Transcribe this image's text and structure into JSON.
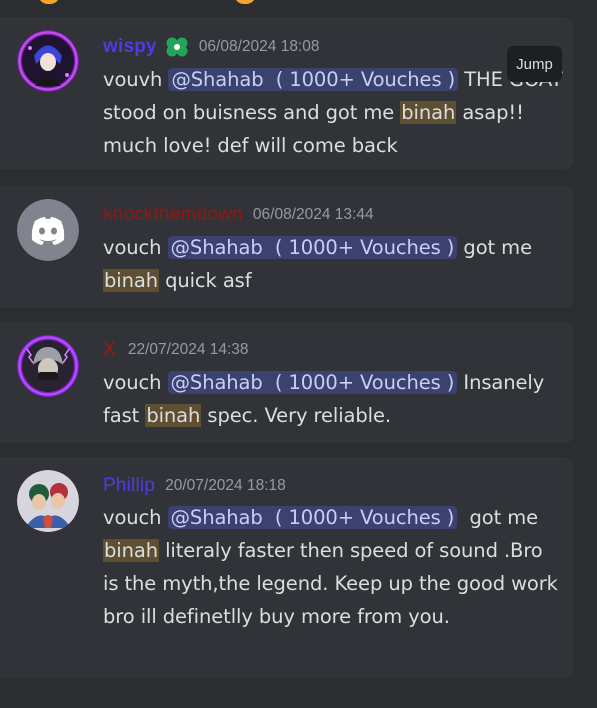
{
  "messages": [
    {
      "username": "wispy",
      "name_color": "#4f3be6",
      "timestamp": "06/08/2024 18:08",
      "parts": [
        "vouvh ",
        "@Shahab  ( 1000+ Vouches )",
        " THE GOAT stood on buisness and got me ",
        "binah",
        " asap!! much love! def will come back"
      ],
      "jump_label": "Jump"
    },
    {
      "username": "knockthemdown",
      "name_color": "#8b1a14",
      "timestamp": "06/08/2024 13:44",
      "parts": [
        "vouch ",
        "@Shahab  ( 1000+ Vouches )",
        " got me ",
        "binah",
        " quick asf"
      ]
    },
    {
      "username": "X",
      "name_color": "#9c1a12",
      "timestamp": "22/07/2024 14:38",
      "parts": [
        "vouch ",
        "@Shahab  ( 1000+ Vouches )",
        " Insanely fast ",
        "binah",
        " spec. Very reliable."
      ]
    },
    {
      "username": "Phillip",
      "name_color": "#4f3be6",
      "timestamp": "20/07/2024 18:18",
      "parts": [
        "vouch ",
        "@Shahab  ( 1000+ Vouches )",
        "  got me ",
        "binah",
        " literaly faster then speed of sound .Bro is the myth,the legend. Keep up the good work bro ill definetlly buy more from you."
      ]
    }
  ],
  "colors": {
    "background": "#2b2d31",
    "card": "#313338",
    "text": "#dbdee1",
    "timestamp": "#949ba4",
    "mention_bg": "#3c4270",
    "mention_text": "#c9cdfb",
    "highlight": "#5e4f33",
    "discord_blurple": "#5865f2"
  },
  "icons": {
    "badge": "green-clover-icon",
    "default_avatar": "discord-logo-icon"
  }
}
